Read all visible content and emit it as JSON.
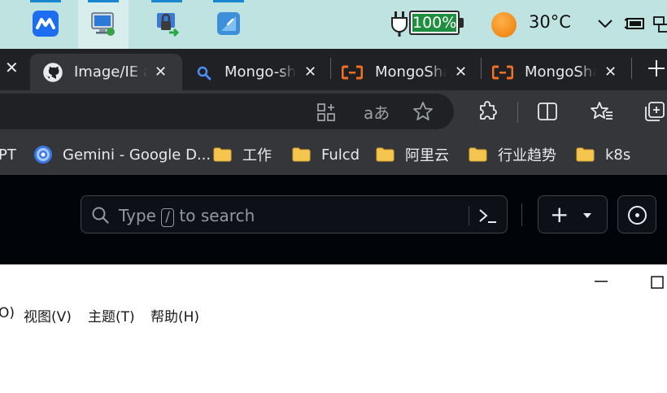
{
  "taskbar": {
    "apps": [
      {
        "icon": "tencent-meeting-icon",
        "color": "#1c6df0"
      },
      {
        "icon": "remote-desktop-icon",
        "color": "#2b7bd6"
      },
      {
        "icon": "vpn-lock-icon",
        "color": "#3a7bd5"
      },
      {
        "icon": "network-drive-icon",
        "color": "#3c8fd8"
      }
    ],
    "battery": {
      "percent": "100%",
      "fill_color": "#1e8f3e"
    },
    "weather": {
      "temperature": "30°C",
      "icon": "sun-icon"
    }
  },
  "browser": {
    "tabs": [
      {
        "label": "Image/IE a",
        "icon": "github-icon",
        "active": true
      },
      {
        "label": "Mongo-sha",
        "icon": "search-icon",
        "active": false
      },
      {
        "label": "MongoSha",
        "icon": "aliyun-icon",
        "active": false
      },
      {
        "label": "MongoSha",
        "icon": "aliyun-icon",
        "active": false
      }
    ],
    "bookmarks": [
      {
        "label": "PT",
        "icon": null
      },
      {
        "label": "Gemini - Google D...",
        "icon": "gemini-icon"
      },
      {
        "label": "工作",
        "icon": "folder-icon"
      },
      {
        "label": "Fulcd",
        "icon": "folder-icon"
      },
      {
        "label": "阿里云",
        "icon": "folder-icon"
      },
      {
        "label": "行业趋势",
        "icon": "folder-icon"
      },
      {
        "label": "k8s",
        "icon": "folder-icon"
      }
    ],
    "accent": "#f36f21",
    "folder_color": "#f5c64f"
  },
  "github": {
    "search": {
      "prefix": "Type",
      "key": "/",
      "suffix": "to search"
    },
    "create_label": "+"
  },
  "app_window": {
    "menu": [
      {
        "label": "O)"
      },
      {
        "label": "视图(V)"
      },
      {
        "label": "主题(T)"
      },
      {
        "label": "帮助(H)"
      }
    ]
  }
}
